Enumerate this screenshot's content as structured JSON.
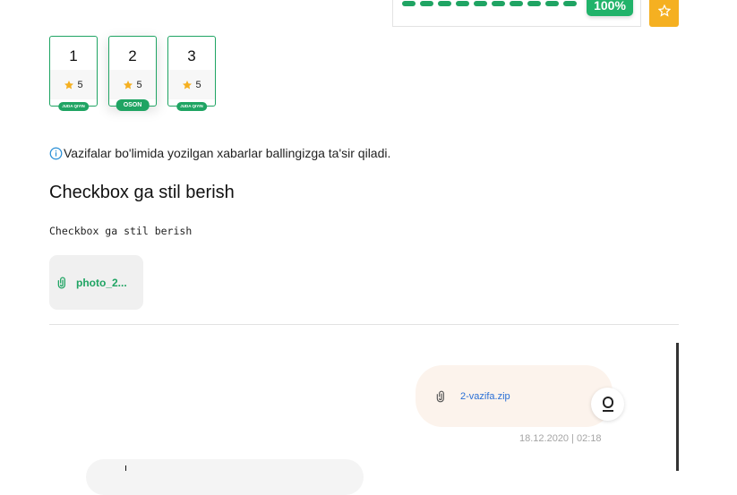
{
  "progress": {
    "percent_label": "100%",
    "segments": 10,
    "color": "#1fa463"
  },
  "tasks": [
    {
      "number": "1",
      "rating": "5",
      "difficulty": "JUDA QIYIN"
    },
    {
      "number": "2",
      "rating": "5",
      "difficulty": "OSON"
    },
    {
      "number": "3",
      "rating": "5",
      "difficulty": "JUDA QIYIN"
    }
  ],
  "info_text": "Vazifalar bo'limida yozilgan xabarlar ballingizga ta'sir qiladi.",
  "task_title": "Checkbox ga stil berish",
  "task_description": "Checkbox ga stil berish",
  "attachment": {
    "label": "photo_2...",
    "icon": "paperclip-icon"
  },
  "chat": {
    "message_file": "2-vazifa.zip",
    "timestamp": "18.12.2020 | 02:18"
  },
  "colors": {
    "accent": "#1fa463",
    "star": "#f5b021",
    "bubble": "#fcf3ec",
    "link": "#2a6fd6"
  }
}
